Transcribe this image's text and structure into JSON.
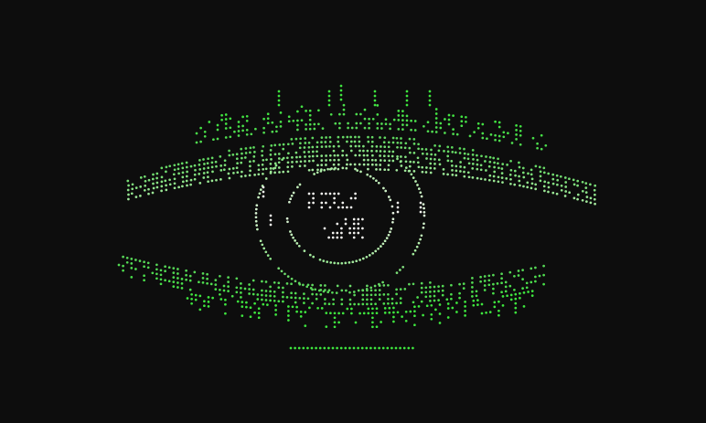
{
  "scene": {
    "subject": "eye-icon",
    "style": "braille-dot-matrix",
    "colors": {
      "background": "#0d0d0d",
      "green_bright": "#3ee63e",
      "green_mid": "#5ad65a",
      "green_pale": "#b8efb0",
      "white_dot": "#f2f2ee"
    }
  }
}
